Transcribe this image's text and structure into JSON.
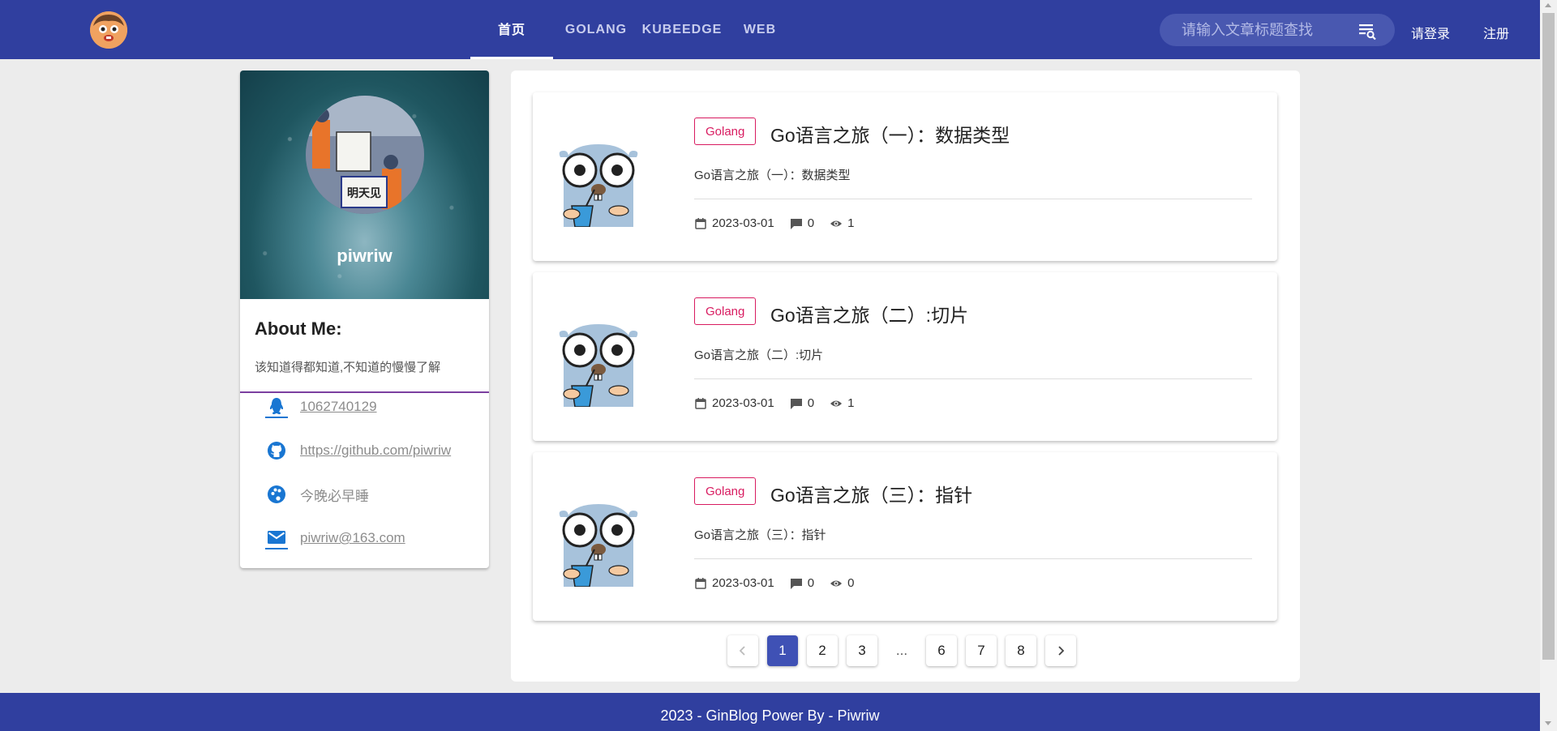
{
  "header": {
    "nav": [
      {
        "label": "首页",
        "active": true
      },
      {
        "label": "GOLANG",
        "active": false
      },
      {
        "label": "KUBEEDGE",
        "active": false
      },
      {
        "label": "WEB",
        "active": false
      }
    ],
    "search_placeholder": "请输入文章标题查找",
    "login_label": "请登录",
    "register_label": "注册",
    "bar_color": "#303f9f"
  },
  "profile": {
    "name": "piwriw",
    "about_title": "About Me:",
    "about_desc": "该知道得都知道,不知道的慢慢了解",
    "avatar_sign_text": "明天见",
    "contacts": [
      {
        "icon": "qq-icon",
        "text": "1062740129"
      },
      {
        "icon": "github-icon",
        "text": "https://github.com/piwriw"
      },
      {
        "icon": "palette-icon",
        "text": "今晚必早睡"
      },
      {
        "icon": "email-icon",
        "text": "piwriw@163.com"
      }
    ]
  },
  "articles": [
    {
      "tag": "Golang",
      "title": "Go语言之旅（一）：数据类型",
      "desc": "Go语言之旅（一）：数据类型",
      "date": "2023-03-01",
      "comments": "0",
      "views": "1"
    },
    {
      "tag": "Golang",
      "title": "Go语言之旅（二）:切片",
      "desc": "Go语言之旅（二）:切片",
      "date": "2023-03-01",
      "comments": "0",
      "views": "1"
    },
    {
      "tag": "Golang",
      "title": "Go语言之旅（三）：指针",
      "desc": "Go语言之旅（三）：指针",
      "date": "2023-03-01",
      "comments": "0",
      "views": "0"
    }
  ],
  "pagination": {
    "pages": [
      "1",
      "2",
      "3",
      "...",
      "6",
      "7",
      "8"
    ],
    "current": "1"
  },
  "footer": {
    "text": "2023 - GinBlog Power By - Piwriw"
  },
  "colors": {
    "primary": "#303f9f",
    "tag": "#d81b60",
    "active_page": "#3f51b5"
  }
}
